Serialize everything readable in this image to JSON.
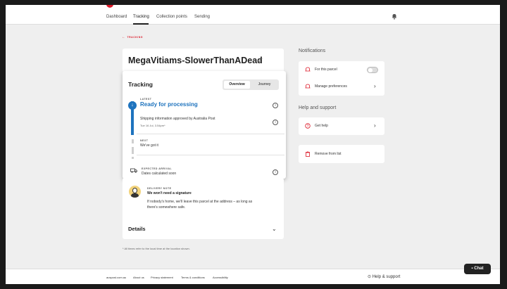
{
  "nav": {
    "items": [
      "Dashboard",
      "Tracking",
      "Collection points",
      "Sending"
    ],
    "active": "Tracking"
  },
  "breadcrumb": {
    "back_label": "TRACKING"
  },
  "parcel": {
    "title": "MegaVitiams-SlowerThanADead"
  },
  "tracking": {
    "heading": "Tracking",
    "tabs": [
      "Overview",
      "Journey"
    ],
    "active_tab": "Overview",
    "latest": {
      "label": "LATEST",
      "status": "Ready for processing",
      "event_text": "Shipping information approved by Australia Post",
      "event_time": "Tue 16 Jul, 3.54pm*"
    },
    "next": {
      "label": "NEXT",
      "text": "We've got it"
    },
    "expected": {
      "label": "EXPECTED ARRIVAL",
      "text": "Dates calculated soon"
    }
  },
  "delivery_note": {
    "label": "DELIVERY NOTE",
    "title": "We won't need a signature",
    "body": "If nobody's home, we'll leave this parcel at the address – as long as there's somewhere safe."
  },
  "details": {
    "heading": "Details"
  },
  "footnote": "* All times refer to the local time at the location shown.",
  "notifications": {
    "heading": "Notifications",
    "for_parcel_label": "For this parcel",
    "for_parcel_enabled": false,
    "manage_label": "Manage preferences"
  },
  "help": {
    "heading": "Help and support",
    "get_help_label": "Get help",
    "remove_label": "Remove from list"
  },
  "footer": {
    "links": [
      "auspost.com.au",
      "About us",
      "Privacy statement",
      "Terms & conditions",
      "Accessibility"
    ],
    "help_label": "Help & support"
  },
  "chat": {
    "label": "Chat"
  },
  "colors": {
    "accent": "#dc1928",
    "primary_blue": "#1e73be"
  }
}
